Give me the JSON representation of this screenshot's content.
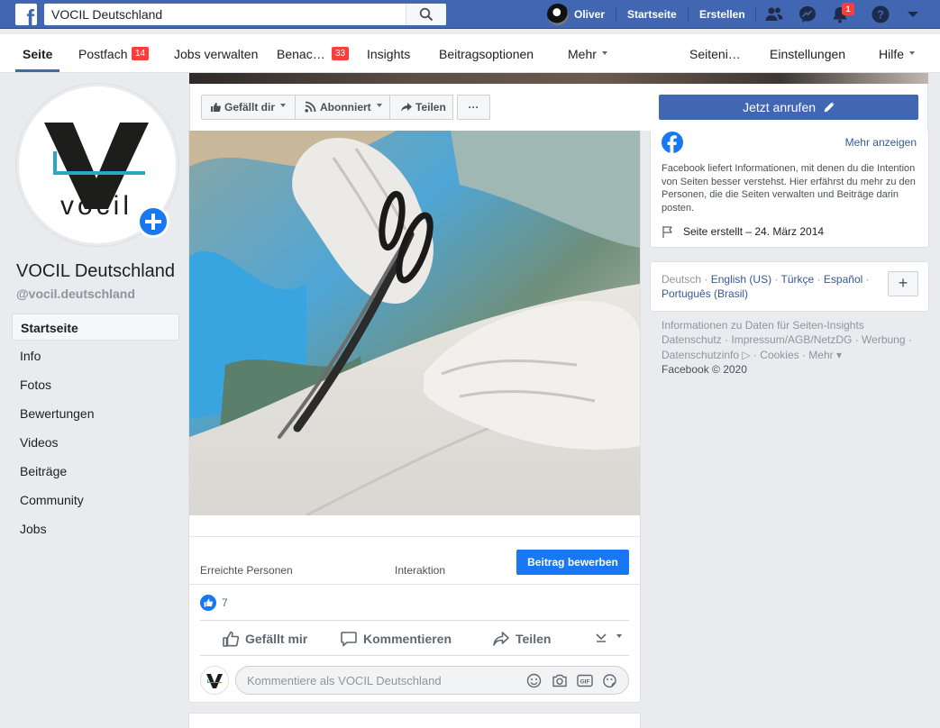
{
  "topbar": {
    "search_value": "VOCIL Deutschland",
    "user_name": "Oliver",
    "home_label": "Startseite",
    "create_label": "Erstellen",
    "notification_count": "1",
    "icons": [
      "facebook-logo",
      "search-icon",
      "friends-icon",
      "messenger-icon",
      "bell-icon",
      "help-icon",
      "caret-down-icon"
    ]
  },
  "pagenav": {
    "tabs": [
      {
        "label": "Seite"
      },
      {
        "label": "Postfach",
        "badge": "14"
      },
      {
        "label": "Jobs verwalten"
      },
      {
        "label": "Benac…",
        "badge": "33"
      },
      {
        "label": "Insights"
      },
      {
        "label": "Beitragsoptionen"
      },
      {
        "label": "Mehr"
      }
    ],
    "right_tabs": [
      {
        "label": "Seiteni…"
      },
      {
        "label": "Einstellungen"
      },
      {
        "label": "Hilfe"
      }
    ]
  },
  "profile": {
    "name": "VOCIL Deutschland",
    "handle": "@vocil.deutschland",
    "logo_text": "vocil"
  },
  "sidebar": {
    "items": [
      {
        "label": "Startseite",
        "active": true
      },
      {
        "label": "Info"
      },
      {
        "label": "Fotos"
      },
      {
        "label": "Bewertungen"
      },
      {
        "label": "Videos"
      },
      {
        "label": "Beiträge"
      },
      {
        "label": "Community"
      },
      {
        "label": "Jobs"
      }
    ]
  },
  "actionbar": {
    "like_label": "Gefällt dir",
    "follow_label": "Abonniert",
    "share_label": "Teilen",
    "more_label": "···",
    "call_label": "Jetzt anrufen"
  },
  "post": {
    "reach_label": "Erreichte Personen",
    "interaction_label": "Interaktion",
    "promote_label": "Beitrag bewerben",
    "like_count": "7",
    "like_action": "Gefällt mir",
    "comment_action": "Kommentieren",
    "share_action": "Teilen",
    "comment_placeholder": "Kommentiere als VOCIL Deutschland",
    "gif_label": "GIF"
  },
  "transparency": {
    "more_label": "Mehr anzeigen",
    "description": "Facebook liefert Informationen, mit denen du die Intention von Seiten besser verstehst. Hier erfährst du mehr zu den Personen, die die Seiten verwalten und Beiträge darin posten.",
    "created": "Seite erstellt – 24. März 2014"
  },
  "languages": {
    "current": "Deutsch",
    "others": [
      "English (US)",
      "Türkçe",
      "Español",
      "Português (Brasil)"
    ],
    "separator": "·",
    "add_label": "+"
  },
  "footer": {
    "line1": "Informationen zu Daten für Seiten-Insights",
    "line2": "Datenschutz · Impressum/AGB/NetzDG · Werbung ·",
    "line3": "Datenschutzinfo ▷ · Cookies · Mehr ▾",
    "copyright": "Facebook © 2020"
  },
  "colors": {
    "brand_blue": "#4267b2",
    "button_blue": "#1877f2",
    "badge_red": "#fa3e3e",
    "link_blue": "#365899",
    "page_bg": "#e9ebee"
  }
}
